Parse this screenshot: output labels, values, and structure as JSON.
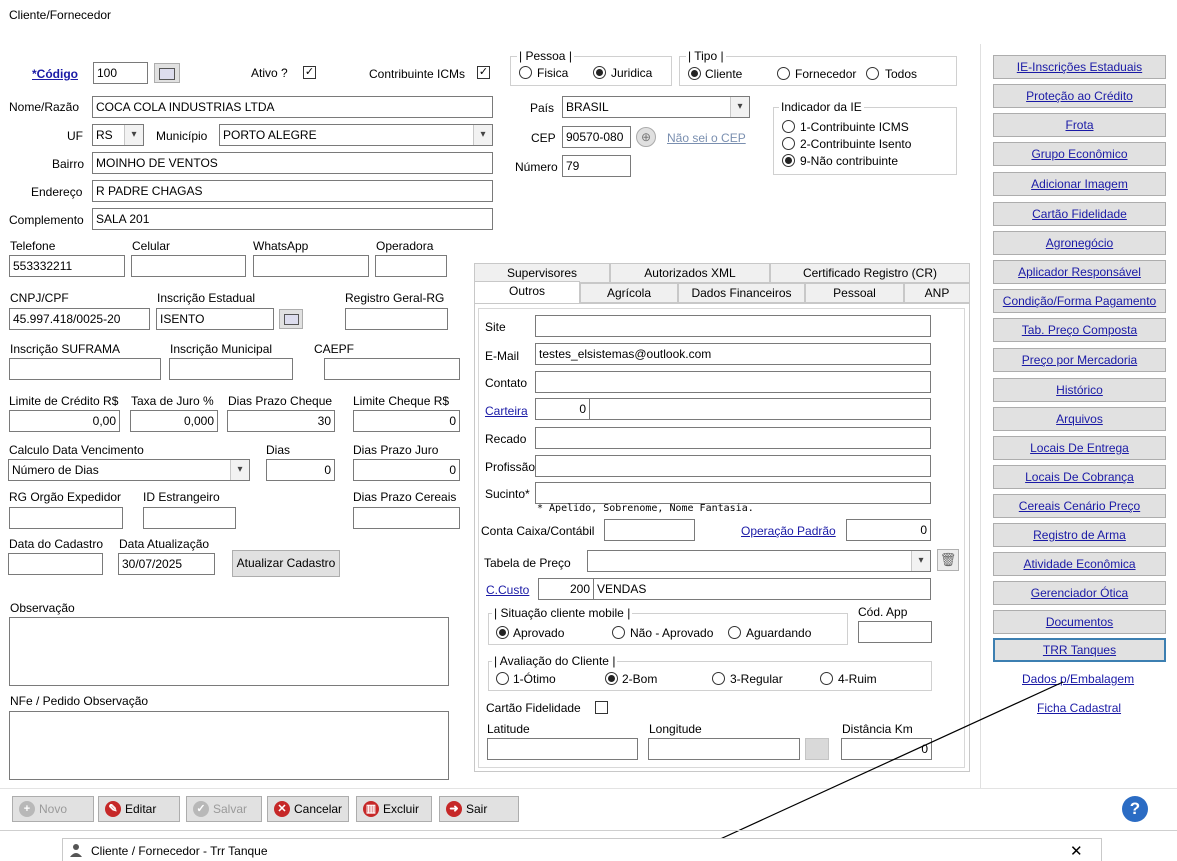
{
  "window": {
    "title": "Cliente/Fornecedor"
  },
  "main": {
    "codigo": {
      "label": "*Código",
      "value": "100"
    },
    "ativo_label": "Ativo ?",
    "contribuinte_label": "Contribuinte ICMs",
    "pessoa": {
      "title": "Pessoa",
      "fisica": "Fisica",
      "juridica": "Juridica"
    },
    "tipo": {
      "title": "Tipo",
      "cliente": "Cliente",
      "fornecedor": "Fornecedor",
      "todos": "Todos"
    },
    "nome": {
      "label": "Nome/Razão",
      "value": "COCA COLA INDUSTRIAS LTDA"
    },
    "uf": {
      "label": "UF",
      "value": "RS"
    },
    "municipio": {
      "label": "Município",
      "value": "PORTO ALEGRE"
    },
    "bairro": {
      "label": "Bairro",
      "value": "MOINHO DE VENTOS"
    },
    "endereco": {
      "label": "Endereço",
      "value": "R PADRE CHAGAS"
    },
    "complemento": {
      "label": "Complemento",
      "value": "SALA 201"
    },
    "pais": {
      "label": "País",
      "value": "BRASIL"
    },
    "cep": {
      "label": "CEP",
      "value": "90570-080",
      "nao_sei": "Não sei o CEP"
    },
    "numero": {
      "label": "Número",
      "value": "79"
    },
    "indicador_ie": {
      "title": "Indicador da IE",
      "opt1": "1-Contribuinte ICMS",
      "opt2": "2-Contribuinte Isento",
      "opt9": "9-Não contribuinte"
    },
    "telefone": {
      "label": "Telefone",
      "value": "553332211"
    },
    "celular_label": "Celular",
    "whatsapp_label": "WhatsApp",
    "operadora_label": "Operadora",
    "cnpj": {
      "label": "CNPJ/CPF",
      "value": "45.997.418/0025-20"
    },
    "ie": {
      "label": "Inscrição Estadual",
      "value": "ISENTO"
    },
    "rg_label": "Registro Geral-RG",
    "suframa_label": "Inscrição SUFRAMA",
    "municipal_label": "Inscrição Municipal",
    "caepf_label": "CAEPF",
    "limite_credito": {
      "label": "Limite de Crédito R$",
      "value": "0,00"
    },
    "taxa_juro": {
      "label": "Taxa de Juro %",
      "value": "0,000"
    },
    "dias_prazo_cheque": {
      "label": "Dias Prazo Cheque",
      "value": "30"
    },
    "limite_cheque": {
      "label": "Limite Cheque R$",
      "value": "0"
    },
    "calculo_venc": {
      "label": "Calculo Data Vencimento",
      "value": "Número de Dias"
    },
    "dias": {
      "label": "Dias",
      "value": "0"
    },
    "dias_prazo_juro": {
      "label": "Dias Prazo Juro",
      "value": "0"
    },
    "rg_orgao_label": "RG Orgão Expedidor",
    "id_estrangeiro_label": "ID Estrangeiro",
    "dias_prazo_cereais_label": "Dias Prazo Cereais",
    "data_cadastro_label": "Data do Cadastro",
    "data_atualizacao": {
      "label": "Data Atualização",
      "value": "30/07/2025"
    },
    "atualizar_btn": "Atualizar Cadastro",
    "observacao_label": "Observação",
    "nfe_obs_label": "NFe / Pedido Observação"
  },
  "tabs": {
    "row1": [
      "Supervisores",
      "Autorizados XML",
      "Certificado Registro (CR)"
    ],
    "row2": [
      "Outros",
      "Agrícola",
      "Dados Financeiros",
      "Pessoal",
      "ANP"
    ]
  },
  "outros": {
    "site_label": "Site",
    "email": {
      "label": "E-Mail",
      "value": "testes_elsistemas@outlook.com"
    },
    "contato_label": "Contato",
    "carteira": {
      "label": "Carteira",
      "value": "0"
    },
    "recado_label": "Recado",
    "profissao_label": "Profissão",
    "sucinto_label": "Sucinto*",
    "sucinto_hint": "* Apelido, Sobrenome, Nome Fantasia.",
    "conta_caixa_label": "Conta Caixa/Contábil",
    "operacao_padrao": {
      "label": "Operação Padrão",
      "value": "0"
    },
    "tabela_preco_label": "Tabela de Preço",
    "ccusto": {
      "label": "C.Custo",
      "code": "200",
      "name": "VENDAS"
    },
    "situacao": {
      "title": "Situação cliente mobile",
      "aprovado": "Aprovado",
      "nao_aprovado": "Não - Aprovado",
      "aguardando": "Aguardando"
    },
    "cod_app_label": "Cód. App",
    "avaliacao": {
      "title": "Avaliação do Cliente",
      "o1": "1-Ótimo",
      "o2": "2-Bom",
      "o3": "3-Regular",
      "o4": "4-Ruim"
    },
    "cartao_fidelidade_label": "Cartão Fidelidade",
    "latitude_label": "Latitude",
    "longitude_label": "Longitude",
    "distancia": {
      "label": "Distância Km",
      "value": "0"
    }
  },
  "side_buttons": [
    "IE-Inscrições Estaduais",
    "Proteção ao Crédito",
    "Frota",
    "Grupo Econômico",
    "Adicionar Imagem",
    "Cartão Fidelidade",
    "Agronegócio",
    "Aplicador Responsável",
    "Condição/Forma Pagamento",
    "Tab. Preço Composta",
    "Preço por Mercadoria",
    "Histórico",
    "Arquivos",
    "Locais De Entrega",
    "Locais De Cobrança",
    "Cereais Cenário Preço",
    "Registro de Arma",
    "Atividade Econômica",
    "Gerenciador Ótica",
    "Documentos",
    "TRR Tanques"
  ],
  "side_links": [
    "Dados p/Embalagem",
    "Ficha Cadastral"
  ],
  "toolbar": {
    "novo": "Novo",
    "editar": "Editar",
    "salvar": "Salvar",
    "cancelar": "Cancelar",
    "excluir": "Excluir",
    "sair": "Sair"
  },
  "colors": {
    "novo": "#b0b0b0",
    "editar": "#c62828",
    "salvar": "#b0b0b0",
    "cancelar": "#c62828",
    "excluir": "#c62828",
    "sair": "#c62828",
    "help": "#2b6cc4"
  },
  "subwindow": {
    "title": "Cliente / Fornecedor - Trr Tanque",
    "close": "✕"
  }
}
